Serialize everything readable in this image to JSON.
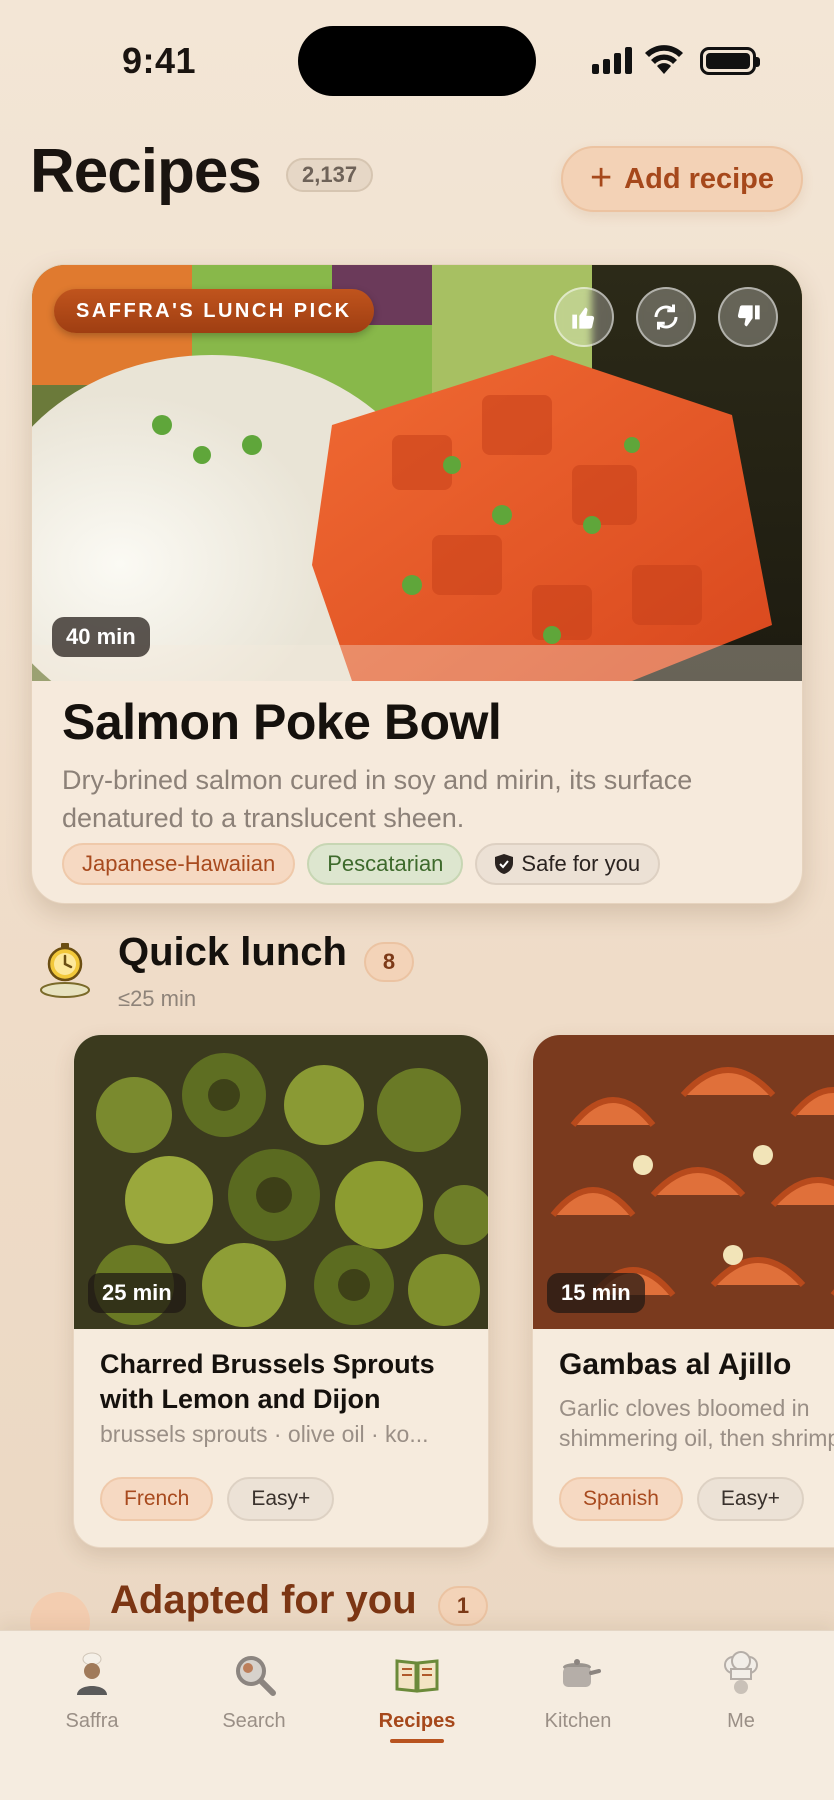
{
  "status_bar": {
    "time": "9:41"
  },
  "header": {
    "title": "Recipes",
    "count": "2,137",
    "add_label": "Add recipe"
  },
  "featured": {
    "pick_label": "SAFFRA'S LUNCH PICK",
    "time": "40 min",
    "title": "Salmon Poke Bowl",
    "description": "Dry-brined salmon cured in soy and mirin, its surface denatured to a translucent sheen.",
    "tags": {
      "cuisine": "Japanese-Hawaiian",
      "diet": "Pescatarian",
      "safety": "Safe for you"
    }
  },
  "quick_lunch": {
    "title": "Quick lunch",
    "count": "8",
    "subtitle": "≤25 min",
    "cards": [
      {
        "time": "25 min",
        "title": "Charred Brussels Sprouts with Lemon and Dijon",
        "subtitle": "brussels sprouts · olive oil · ko...",
        "cuisine": "French",
        "level": "Easy+"
      },
      {
        "time": "15 min",
        "title": "Gambas al Ajillo",
        "subtitle": "Garlic cloves bloomed in shimmering oil, then shrimp",
        "cuisine": "Spanish",
        "level": "Easy+"
      }
    ]
  },
  "adapted": {
    "title": "Adapted for you",
    "count": "1"
  },
  "tabs": [
    {
      "label": "Saffra",
      "icon": "chef-avatar-icon",
      "active": false
    },
    {
      "label": "Search",
      "icon": "search-icon",
      "active": false
    },
    {
      "label": "Recipes",
      "icon": "recipe-book-icon",
      "active": true
    },
    {
      "label": "Kitchen",
      "icon": "pot-icon",
      "active": false
    },
    {
      "label": "Me",
      "icon": "chef-hat-icon",
      "active": false
    }
  ],
  "colors": {
    "accent": "#a6481b",
    "background": "#f3e6d6",
    "card": "#f6eadc"
  }
}
